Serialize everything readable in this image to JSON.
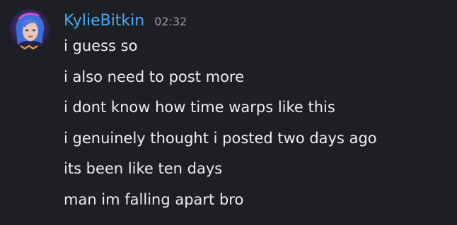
{
  "accent": "#4aa8f0",
  "message_group": {
    "username": "KylieBitkin",
    "timestamp": "02:32",
    "avatar_icon": "user-avatar-icon",
    "messages": [
      "i guess so",
      "i also need to post more",
      "i dont know how time warps like this",
      "i genuinely thought i posted two days ago",
      "its been like ten days",
      "man im falling apart bro"
    ]
  }
}
